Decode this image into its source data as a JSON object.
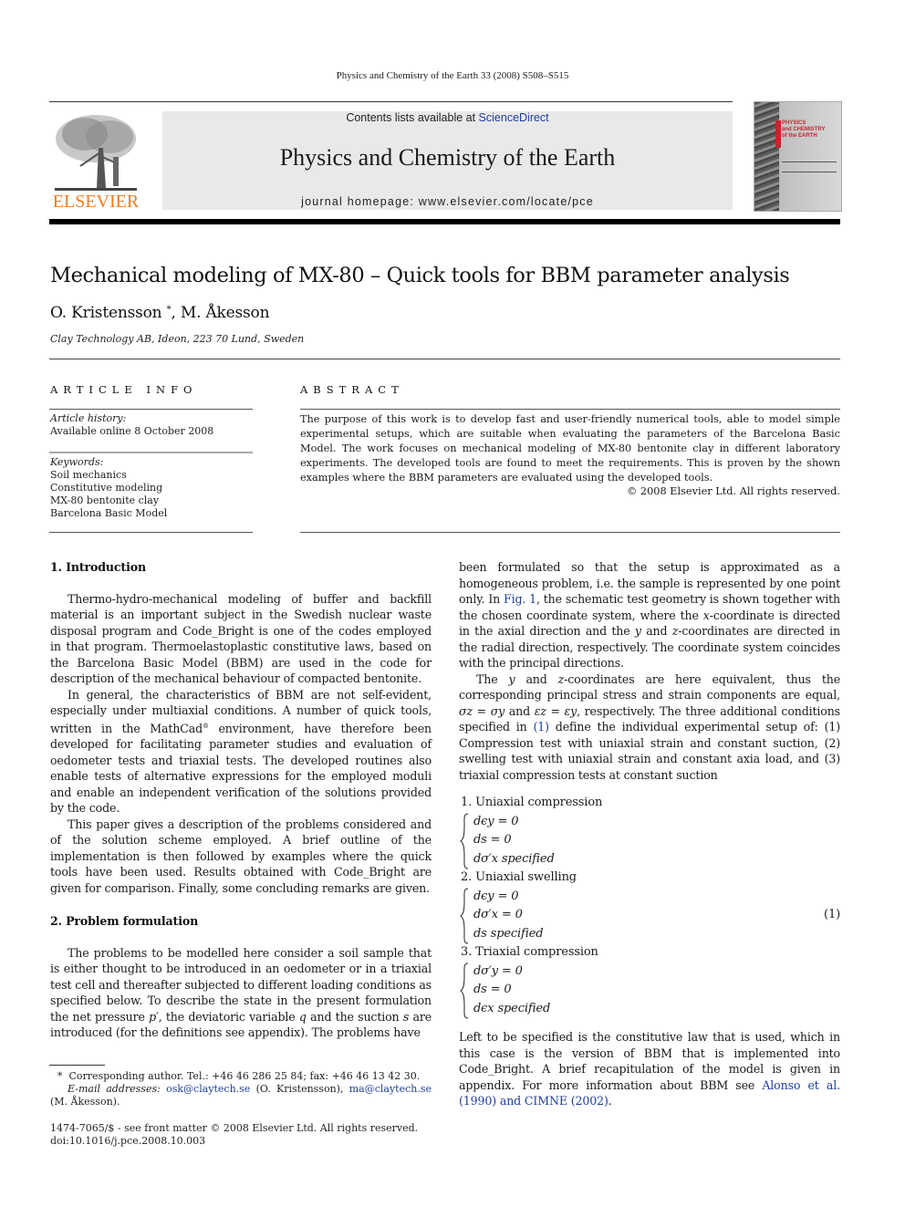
{
  "header": {
    "running_head": "Physics and Chemistry of the Earth 33 (2008) S508–S515",
    "publisher_logo_text": "ELSEVIER",
    "contents_prefix": "Contents lists available at ",
    "contents_link": "ScienceDirect",
    "journal_title": "Physics and Chemistry of the Earth",
    "journal_homepage": "journal homepage: www.elsevier.com/locate/pce",
    "cover_title_lines": [
      "PHYSICS",
      "and CHEMISTRY",
      "of the EARTH"
    ]
  },
  "article": {
    "title": "Mechanical modeling of MX-80 – Quick tools for BBM parameter analysis",
    "authors": "O. Kristensson",
    "author_mark": "*",
    "authors_rest": ", M. Åkesson",
    "affiliation": "Clay Technology AB, Ideon, 223 70 Lund, Sweden"
  },
  "article_info": {
    "label": "ARTICLE INFO",
    "history_label": "Article history:",
    "history_value": "Available online 8 October 2008",
    "keywords_label": "Keywords:",
    "keywords": [
      "Soil mechanics",
      "Constitutive modeling",
      "MX-80 bentonite clay",
      "Barcelona Basic Model"
    ]
  },
  "abstract": {
    "label": "ABSTRACT",
    "text": "The purpose of this work is to develop fast and user-friendly numerical tools, able to model simple experimental setups, which are suitable when evaluating the parameters of the Barcelona Basic Model. The work focuses on mechanical modeling of MX-80 bentonite clay in different laboratory experiments. The developed tools are found to meet the requirements. This is proven by the shown examples where the BBM parameters are evaluated using the developed tools.",
    "copyright": "© 2008 Elsevier Ltd. All rights reserved."
  },
  "sections": {
    "intro": {
      "heading": "1. Introduction",
      "p1": "Thermo-hydro-mechanical modeling of buffer and backfill material is an important subject in the Swedish nuclear waste disposal program and Code_Bright is one of the codes employed in that program. Thermoelastoplastic constitutive laws, based on the Barcelona Basic Model (BBM) are used in the code for description of the mechanical behaviour of compacted bentonite.",
      "p2a": "In general, the characteristics of BBM are not self-evident, especially under multiaxial conditions. A number of quick tools, written in the MathCad",
      "p2_reg": "®",
      "p2b": " environment, have therefore been developed for facilitating parameter studies and evaluation of oedometer tests and triaxial tests. The developed routines also enable tests of alternative expressions for the employed moduli and enable an independent verification of the solutions provided by the code.",
      "p3": "This paper gives a description of the problems considered and of the solution scheme employed. A brief outline of the implementation is then followed by examples where the quick tools have been used. Results obtained with Code_Bright are given for comparison. Finally, some concluding remarks are given."
    },
    "problem": {
      "heading": "2. Problem formulation",
      "p1a": "The problems to be modelled here consider a soil sample that is either thought to be introduced in an oedometer or in a triaxial test cell and thereafter subjected to different loading conditions as specified below. To describe the state in the present formulation the net pressure ",
      "p1_var1": "p′",
      "p1b": ", the deviatoric variable ",
      "p1_var2": "q",
      "p1c": " and the suction ",
      "p1_var3": "s",
      "p1d": " are introduced (for the definitions see appendix). The problems have",
      "right_p1a": "been formulated so that the setup is approximated as a homogeneous problem, i.e. the sample is represented by one point only. In ",
      "right_fig_link": "Fig. 1",
      "right_p1b": ", the schematic test geometry is shown together with the chosen coordinate system, where the ",
      "right_x": "x",
      "right_p1c": "-coordinate is directed in the axial direction and the ",
      "right_y": "y",
      "right_p1d": " and ",
      "right_z": "z",
      "right_p1e": "-coordinates are directed in the radial direction, respectively. The coordinate system coincides with the principal directions.",
      "right_p2a": "The ",
      "right_p2b": " and ",
      "right_p2c": "-coordinates are here equivalent, thus the corresponding principal stress and strain components are equal, ",
      "right_sigma_eq": "σz = σy",
      "right_p2d": " and ",
      "right_eps_eq": "εz = εy",
      "right_p2e": ", respectively. The three additional conditions specified in ",
      "right_eq_link": "(1)",
      "right_p2f": " define the individual experimental setup of: (1) Compression test with uniaxial strain and constant suction, (2) swelling test with uniaxial strain and constant axia load, and (3) triaxial compression tests at constant suction",
      "equations": [
        {
          "title": "1. Uniaxial compression",
          "lines": [
            "dϵy = 0",
            "ds = 0",
            "dσ′x   specified"
          ]
        },
        {
          "title": "2. Uniaxial swelling",
          "lines": [
            "dϵy = 0",
            "dσ′x = 0",
            "ds   specified"
          ]
        },
        {
          "title": "3. Triaxial compression",
          "lines": [
            "dσ′y = 0",
            "ds = 0",
            "dϵx   specified"
          ]
        }
      ],
      "equation_number": "(1)",
      "right_p3a": "Left to be specified is the constitutive law that is used, which in this case is the version of BBM that is implemented into Code_Bright. A brief recapitulation of the model is given in appendix. For more information about BBM see ",
      "right_ref_link": "Alonso et al. (1990) and CIMNE (2002)",
      "right_p3b": "."
    }
  },
  "footnotes": {
    "mark": "*",
    "corresponding": "Corresponding author. Tel.: +46 46 286 25 84; fax: +46 46 13 42 30.",
    "email_label": "E-mail addresses:",
    "email1": "osk@claytech.se",
    "email1_name": " (O. Kristensson), ",
    "email2": "ma@claytech.se",
    "email2_name": " (M. Åkesson).",
    "front_matter": "1474-7065/$ - see front matter © 2008 Elsevier Ltd. All rights reserved.",
    "doi": "doi:10.1016/j.pce.2008.10.003"
  },
  "colors": {
    "link": "#1f3f9a",
    "elsevier_orange": "#ee7d22",
    "banner_bg": "#e9e9e9"
  }
}
